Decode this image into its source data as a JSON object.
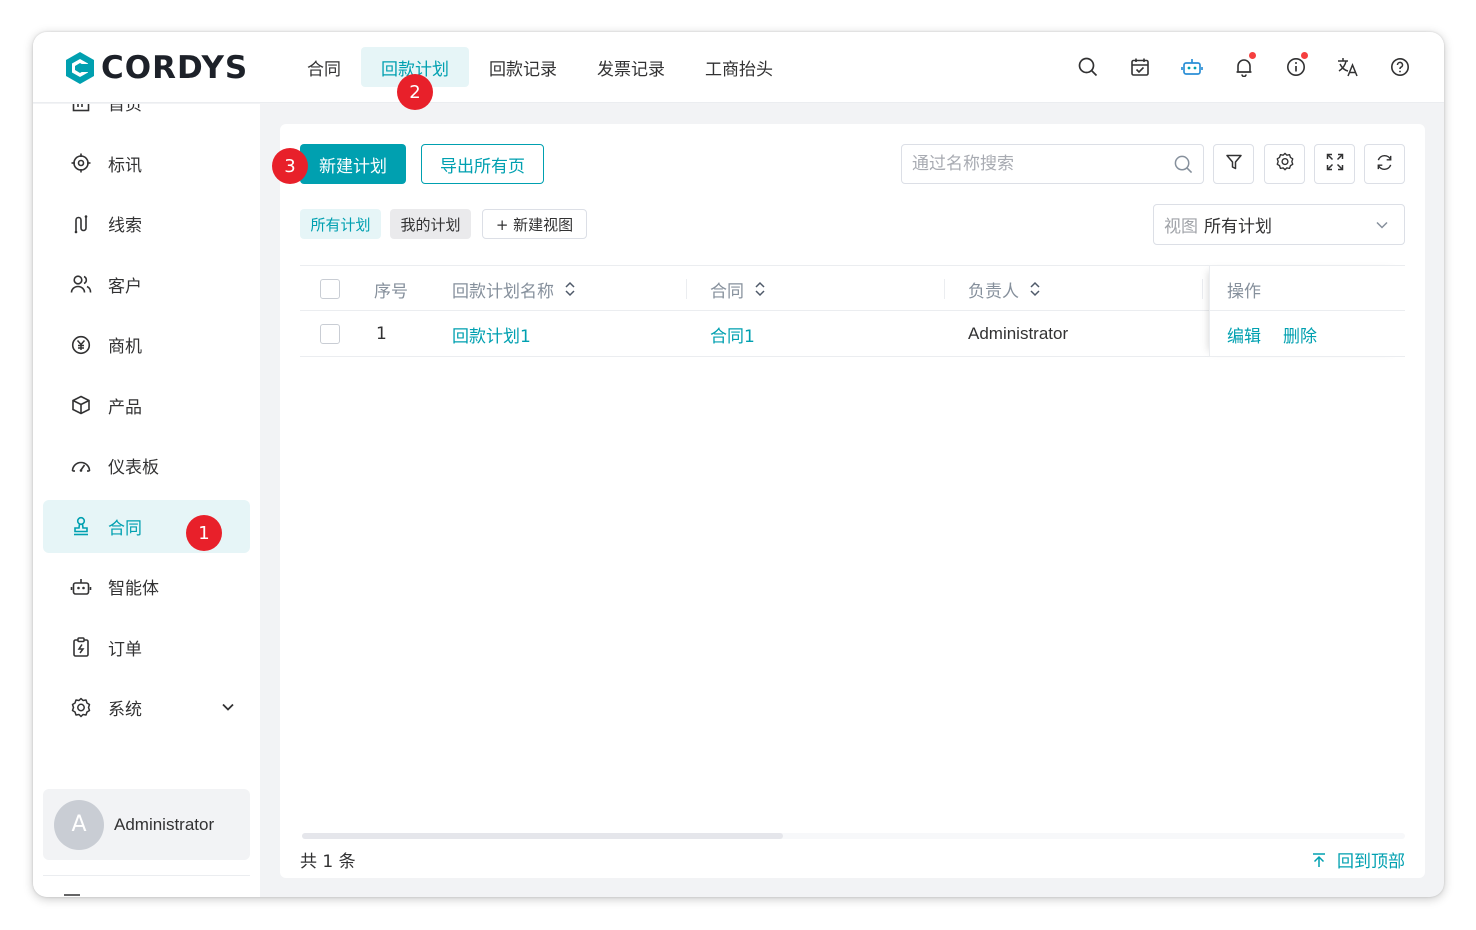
{
  "brand": {
    "name": "CORDYS",
    "color": "#00a0b0"
  },
  "topnav": [
    {
      "label": "合同",
      "active": false
    },
    {
      "label": "回款计划",
      "active": true
    },
    {
      "label": "回款记录",
      "active": false
    },
    {
      "label": "发票记录",
      "active": false
    },
    {
      "label": "工商抬头",
      "active": false
    }
  ],
  "header_icons": [
    "search-icon",
    "calendar-check-icon",
    "robot-icon",
    "bell-icon",
    "info-icon",
    "translate-icon",
    "help-icon"
  ],
  "sidebar": {
    "items": [
      {
        "label": "首页",
        "icon": "home-icon"
      },
      {
        "label": "标讯",
        "icon": "target-icon"
      },
      {
        "label": "线索",
        "icon": "lead-icon"
      },
      {
        "label": "客户",
        "icon": "customer-icon"
      },
      {
        "label": "商机",
        "icon": "yuan-icon"
      },
      {
        "label": "产品",
        "icon": "box-icon"
      },
      {
        "label": "仪表板",
        "icon": "dashboard-icon"
      },
      {
        "label": "合同",
        "icon": "stamp-icon",
        "active": true
      },
      {
        "label": "智能体",
        "icon": "robot-icon"
      },
      {
        "label": "订单",
        "icon": "order-icon"
      },
      {
        "label": "系统",
        "icon": "gear-icon"
      }
    ],
    "user": {
      "initial": "A",
      "name": "Administrator"
    }
  },
  "badges": {
    "b1": "1",
    "b2": "2",
    "b3": "3"
  },
  "toolbar": {
    "new_label": "新建计划",
    "export_label": "导出所有页",
    "search_placeholder": "通过名称搜索"
  },
  "views": {
    "tabs": [
      "所有计划",
      "我的计划",
      "+ 新建视图"
    ],
    "select_prefix": "视图",
    "select_value": "所有计划"
  },
  "table": {
    "headers": {
      "index": "序号",
      "name": "回款计划名称",
      "contract": "合同",
      "owner": "负责人",
      "ops": "操作"
    },
    "rows": [
      {
        "index": "1",
        "name": "回款计划1",
        "contract": "合同1",
        "owner": "Administrator",
        "edit": "编辑",
        "delete": "删除"
      }
    ]
  },
  "footer": {
    "total": "共 1 条",
    "back_top": "回到顶部"
  }
}
